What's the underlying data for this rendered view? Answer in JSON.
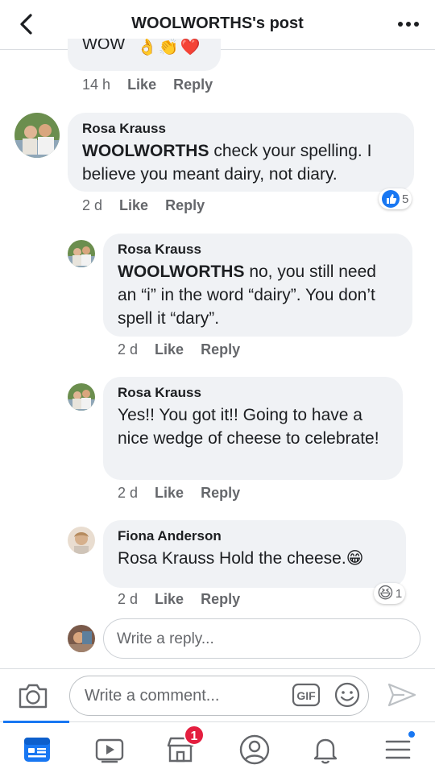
{
  "header": {
    "title": "WOOLWORTHS's post"
  },
  "partial_comment": {
    "text": "WOW",
    "emojis": "👌👏❤️",
    "time": "14 h",
    "like": "Like",
    "reply": "Reply"
  },
  "comments": [
    {
      "author": "Rosa Krauss",
      "mention": "WOOLWORTHS",
      "text": " check your spelling. I believe you meant dairy, not diary.",
      "time": "2 d",
      "like": "Like",
      "reply": "Reply",
      "reaction_count": "5"
    },
    {
      "author": "Rosa Krauss",
      "mention": "WOOLWORTHS",
      "text": " no, you still need an “i” in the word “dairy”. You don’t spell it “dary”.",
      "time": "2 d",
      "like": "Like",
      "reply": "Reply"
    },
    {
      "author": "Rosa Krauss",
      "text": "Yes!! You got it!! Going to have a nice wedge of cheese to celebrate!",
      "time": "2 d",
      "like": "Like",
      "reply": "Reply"
    },
    {
      "author": "Fiona Anderson",
      "text": "Rosa Krauss Hold the cheese.😁",
      "time": "2 d",
      "like": "Like",
      "reply": "Reply",
      "reaction_count": "1"
    }
  ],
  "reply_box": {
    "placeholder": "Write a reply..."
  },
  "composer": {
    "placeholder": "Write a comment...",
    "gif_label": "GIF"
  },
  "bottom_nav": {
    "marketplace_badge": "1"
  },
  "colors": {
    "accent": "#1877f2",
    "bubble": "#f0f2f5",
    "badge": "#e41e3f"
  }
}
